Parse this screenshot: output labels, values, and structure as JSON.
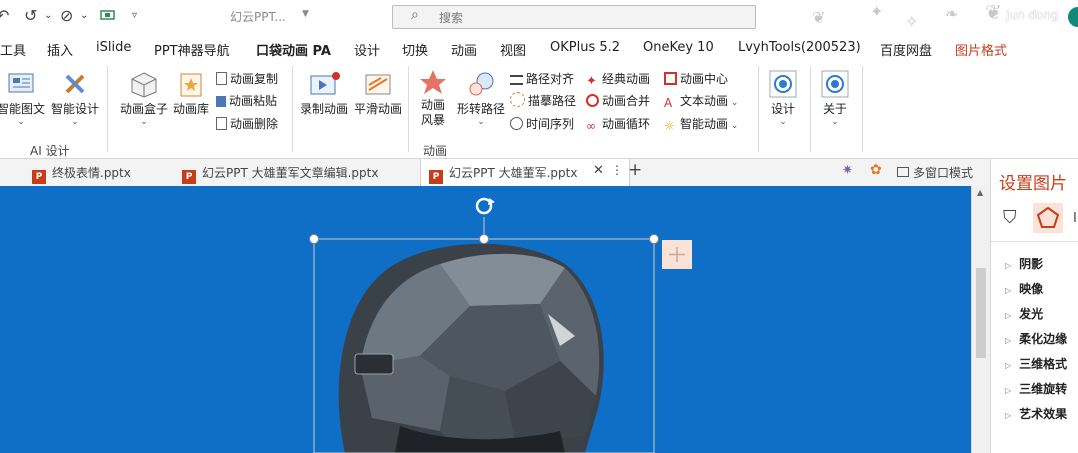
{
  "titlebar": {
    "doc_title": "幻云PPT...",
    "search_placeholder": "搜索",
    "user": "jun dong"
  },
  "tabs": [
    {
      "label": "工具"
    },
    {
      "label": "插入"
    },
    {
      "label": "iSlide"
    },
    {
      "label": "PPT神器导航"
    },
    {
      "label": "口袋动画 PA",
      "active": true
    },
    {
      "label": "设计"
    },
    {
      "label": "切换"
    },
    {
      "label": "动画"
    },
    {
      "label": "视图"
    },
    {
      "label": "OKPlus 5.2"
    },
    {
      "label": "OneKey 10"
    },
    {
      "label": "LvyhTools(200523)"
    },
    {
      "label": "百度网盘"
    },
    {
      "label": "图片格式",
      "contextual": true
    }
  ],
  "ribbon": {
    "ai_group": {
      "label": "AI 设计",
      "btn1": "智能图文",
      "btn2": "智能设计"
    },
    "anim_group": {
      "label": "动画",
      "box": "动画盒子",
      "lib": "动画库",
      "copy": "动画复制",
      "paste": "动画粘贴",
      "del": "动画删除",
      "record": "录制动画",
      "smooth": "平滑动画",
      "storm_1": "动画",
      "storm_2": "风暴",
      "morph": "形转路径",
      "align": "路径对齐",
      "trace": "描摹路径",
      "timeline": "时间序列",
      "classic": "经典动画",
      "merge": "动画合并",
      "loop": "动画循环",
      "center": "动画中心",
      "text": "文本动画",
      "smart": "智能动画"
    },
    "design": "设计",
    "about": "关于"
  },
  "doctabs": {
    "tab1": "终极表情.pptx",
    "tab2": "幻云PPT 大雄董军文章编辑.pptx",
    "tab3": "幻云PPT 大雄董军.pptx",
    "add": "+",
    "multi": "多窗口模式"
  },
  "pane": {
    "title": "设置图片",
    "items": [
      "阴影",
      "映像",
      "发光",
      "柔化边缘",
      "三维格式",
      "三维旋转",
      "艺术效果"
    ]
  },
  "colors": {
    "accent": "#c43e1c",
    "slide_bg": "#0f6fc6"
  }
}
